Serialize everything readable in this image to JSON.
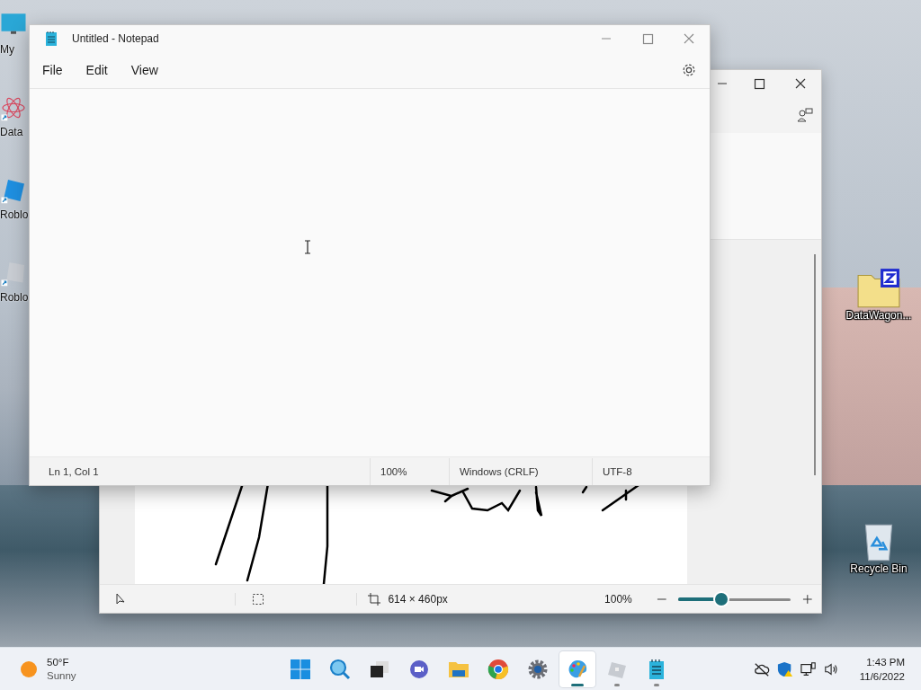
{
  "desktop": {
    "left_icons": [
      {
        "kind": "monitor",
        "label": "My"
      },
      {
        "kind": "atom",
        "label": "Data"
      },
      {
        "kind": "roblox",
        "label": "Roblo"
      },
      {
        "kind": "studio",
        "label": "Roblo"
      }
    ],
    "right_icons": [
      {
        "kind": "zip-folder",
        "label": "DataWagon..."
      },
      {
        "kind": "recycle-bin",
        "label": "Recycle Bin"
      }
    ]
  },
  "paint": {
    "canvas_size": "614 × 460px",
    "zoom": "100%",
    "zoom_slider": {
      "level": 0.38
    }
  },
  "notepad": {
    "title": "Untitled - Notepad",
    "menu": [
      "File",
      "Edit",
      "View"
    ],
    "status_bar": [
      "Ln 1, Col 1",
      "100%",
      "Windows (CRLF)",
      "UTF-8"
    ]
  },
  "taskbar": {
    "weather": {
      "temperature": "50°F",
      "condition": "Sunny"
    },
    "apps": [
      {
        "kind": "start",
        "running": false,
        "selected": false
      },
      {
        "kind": "search",
        "running": false,
        "selected": false
      },
      {
        "kind": "task-view",
        "running": false,
        "selected": false
      },
      {
        "kind": "chat",
        "running": false,
        "selected": false
      },
      {
        "kind": "explorer",
        "running": false,
        "selected": false
      },
      {
        "kind": "chrome",
        "running": false,
        "selected": false
      },
      {
        "kind": "settings",
        "running": false,
        "selected": false
      },
      {
        "kind": "paint",
        "running": true,
        "selected": true
      },
      {
        "kind": "roblox",
        "running": true,
        "selected": false
      },
      {
        "kind": "notepad",
        "running": true,
        "selected": false
      }
    ],
    "clock": {
      "time": "1:43 PM",
      "date": "11/6/2022"
    }
  }
}
